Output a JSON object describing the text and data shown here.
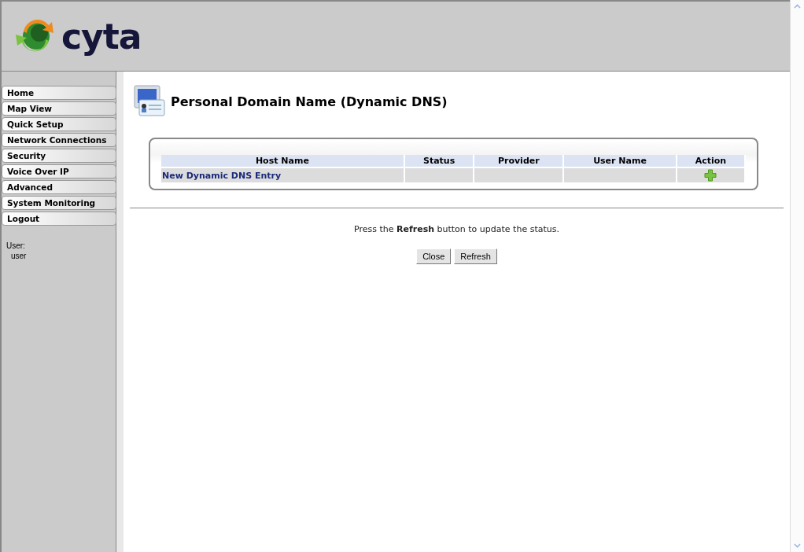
{
  "header": {
    "logo_text": "cyta"
  },
  "sidebar": {
    "items": [
      "Home",
      "Map View",
      "Quick Setup",
      "Network Connections",
      "Security",
      "Voice Over IP",
      "Advanced",
      "System Monitoring",
      "Logout"
    ],
    "user_label": "User:",
    "user_name": "user"
  },
  "page": {
    "title": "Personal Domain Name (Dynamic DNS)"
  },
  "table": {
    "columns": [
      "Host Name",
      "Status",
      "Provider",
      "User Name",
      "Action"
    ],
    "rows": [
      {
        "host_name": "New Dynamic DNS Entry",
        "status": "",
        "provider": "",
        "user_name": ""
      }
    ]
  },
  "message": "Press the **Refresh** button to update the status.",
  "buttons": [
    "Close",
    "Refresh"
  ]
}
